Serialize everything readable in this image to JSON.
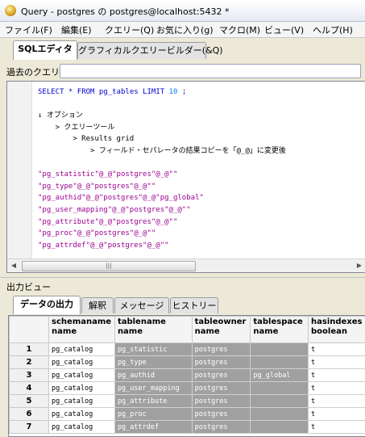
{
  "window": {
    "title": "Query - postgres の postgres@localhost:5432 *"
  },
  "menu": [
    "ファイル(F)",
    "編集(E)",
    "クエリー(Q)",
    "お気に入り(g)",
    "マクロ(M)",
    "ビュー(V)",
    "ヘルプ(H)"
  ],
  "top_tabs": [
    "SQLエディタ",
    "グラフィカルクエリービルダー(&Q)"
  ],
  "history_label": "過去のクエリ",
  "editor": {
    "sql_keyword_select": "SELECT",
    "sql_star": " * ",
    "sql_keyword_from": "FROM",
    "sql_table": " pg_tables ",
    "sql_keyword_limit": "LIMIT",
    "sql_number": "10",
    "sql_end": " ;",
    "note_lines": [
      "↓ オプション",
      "    > クエリーツール",
      "        > Results grid",
      "            > フィールド・セパレータの結果コピーを「@_@」に変更後"
    ],
    "result_lines": [
      "\"pg_statistic\"@_@\"postgres\"@_@\"\"",
      "\"pg_type\"@_@\"postgres\"@_@\"\"",
      "\"pg_authid\"@_@\"postgres\"@_@\"pg_global\"",
      "\"pg_user_mapping\"@_@\"postgres\"@_@\"\"",
      "\"pg_attribute\"@_@\"postgres\"@_@\"\"",
      "\"pg_proc\"@_@\"postgres\"@_@\"\"",
      "\"pg_attrdef\"@_@\"postgres\"@_@\"\""
    ]
  },
  "output_pane_title": "出力ビュー",
  "output_tabs": [
    "データの出力",
    "解釈",
    "メッセージ",
    "ヒストリー"
  ],
  "grid": {
    "columns": [
      {
        "name": "schemaname",
        "type": "name"
      },
      {
        "name": "tablename",
        "type": "name"
      },
      {
        "name": "tableowner",
        "type": "name"
      },
      {
        "name": "tablespace",
        "type": "name"
      },
      {
        "name": "hasindexes",
        "type": "boolean"
      }
    ],
    "rows": [
      {
        "n": "1",
        "schemaname": "pg_catalog",
        "tablename": "pg_statistic",
        "tableowner": "postgres",
        "tablespace": "",
        "hasindexes": "t"
      },
      {
        "n": "2",
        "schemaname": "pg_catalog",
        "tablename": "pg_type",
        "tableowner": "postgres",
        "tablespace": "",
        "hasindexes": "t"
      },
      {
        "n": "3",
        "schemaname": "pg_catalog",
        "tablename": "pg_authid",
        "tableowner": "postgres",
        "tablespace": "pg_global",
        "hasindexes": "t"
      },
      {
        "n": "4",
        "schemaname": "pg_catalog",
        "tablename": "pg_user_mapping",
        "tableowner": "postgres",
        "tablespace": "",
        "hasindexes": "t"
      },
      {
        "n": "5",
        "schemaname": "pg_catalog",
        "tablename": "pg_attribute",
        "tableowner": "postgres",
        "tablespace": "",
        "hasindexes": "t"
      },
      {
        "n": "6",
        "schemaname": "pg_catalog",
        "tablename": "pg_proc",
        "tableowner": "postgres",
        "tablespace": "",
        "hasindexes": "t"
      },
      {
        "n": "7",
        "schemaname": "pg_catalog",
        "tablename": "pg_attrdef",
        "tableowner": "postgres",
        "tablespace": "",
        "hasindexes": "t"
      }
    ]
  },
  "colors": {
    "selection": "#a0a0a0",
    "keyword": "#0000cc",
    "string": "#9b0090"
  },
  "icons": {
    "app": "elephant-icon",
    "scroll_left": "arrow-left-icon",
    "scroll_right": "arrow-right-icon",
    "dropdown": "chevron-down-icon"
  }
}
